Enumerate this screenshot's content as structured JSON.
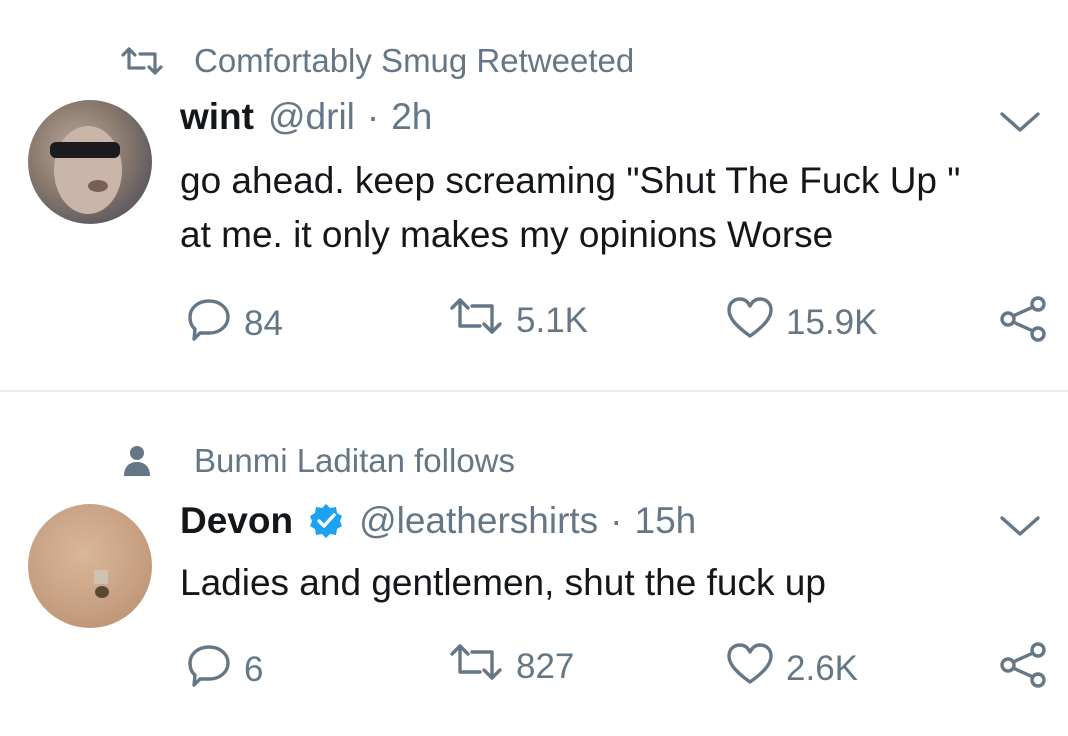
{
  "colors": {
    "muted": "#657786",
    "text": "#14171a",
    "verified": "#1da1f2",
    "divider": "#e6ecf0"
  },
  "tweets": [
    {
      "context_icon": "retweet-icon",
      "context_text": "Comfortably Smug Retweeted",
      "name": "wint",
      "handle": "@dril",
      "separator": "·",
      "time": "2h",
      "verified": false,
      "text_lines": [
        "go ahead. keep screaming \"Shut The Fuck Up \"",
        "at me. it only makes my opinions Worse"
      ],
      "replies": "84",
      "retweets": "5.1K",
      "likes": "15.9K"
    },
    {
      "context_icon": "person-icon",
      "context_text": "Bunmi Laditan follows",
      "name": "Devon",
      "handle": "@leathershirts",
      "separator": "·",
      "time": "15h",
      "verified": true,
      "text_lines": [
        "Ladies and gentlemen, shut the fuck up"
      ],
      "replies": "6",
      "retweets": "827",
      "likes": "2.6K"
    }
  ]
}
